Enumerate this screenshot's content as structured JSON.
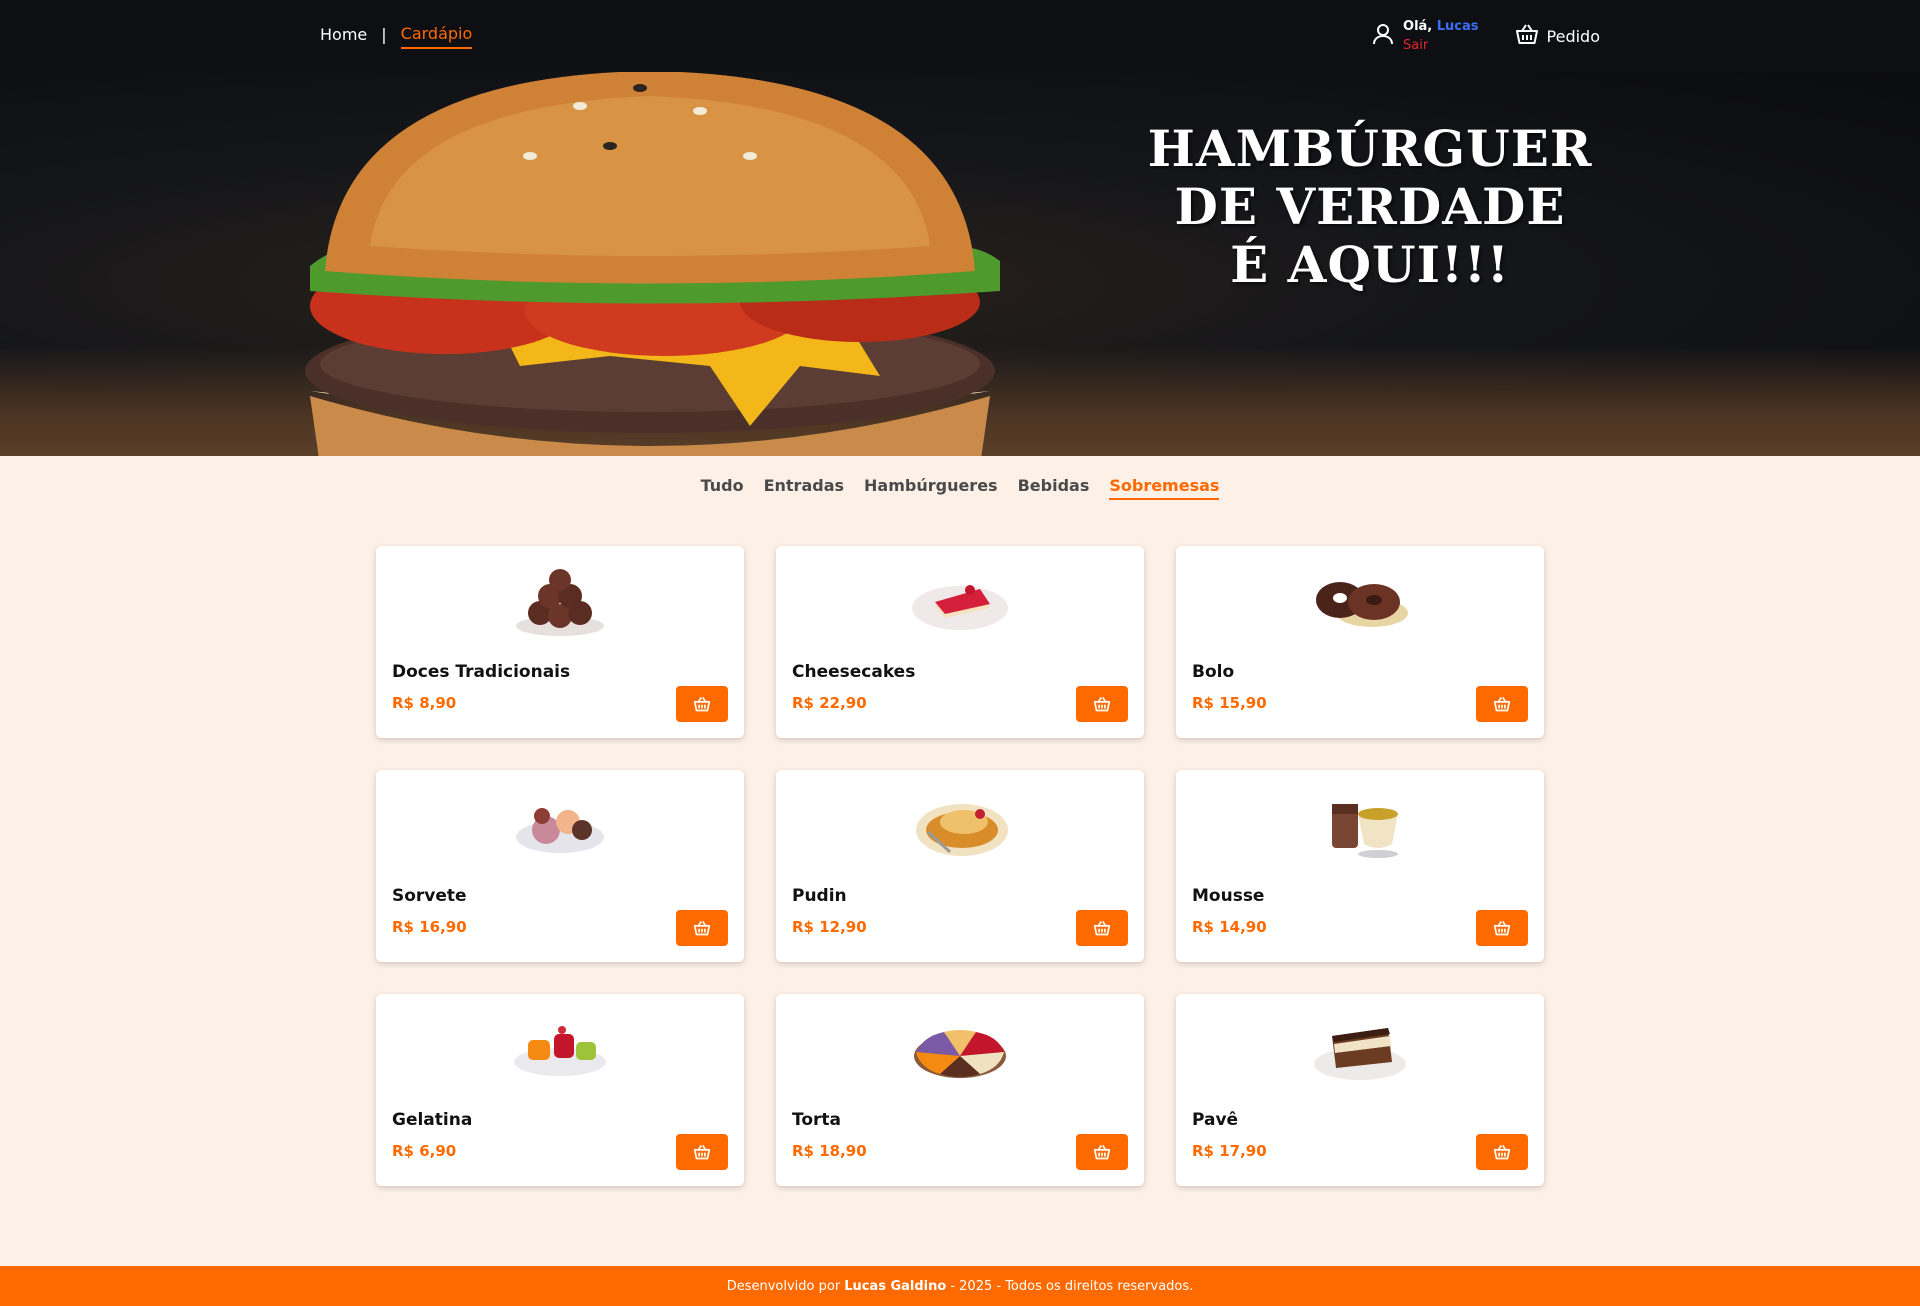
{
  "header": {
    "nav": [
      {
        "label": "Home",
        "active": false
      },
      {
        "label": "Cardápio",
        "active": true
      }
    ],
    "separator": "|",
    "user": {
      "greeting": "Olá,",
      "name": "Lucas",
      "logout": "Sair"
    },
    "cart_label": "Pedido",
    "colors": {
      "bar": "#0d0f13",
      "accent": "#ff6a00",
      "name": "#3b6ff5",
      "logout": "#e5262e"
    }
  },
  "hero": {
    "lines": [
      "HAMBÚRGUER",
      "DE VERDADE",
      "É AQUI!!!"
    ]
  },
  "tabs": [
    {
      "label": "Tudo",
      "active": false
    },
    {
      "label": "Entradas",
      "active": false
    },
    {
      "label": "Hambúrgueres",
      "active": false
    },
    {
      "label": "Bebidas",
      "active": false
    },
    {
      "label": "Sobremesas",
      "active": true
    }
  ],
  "products": [
    {
      "name": "Doces Tradicionais",
      "price": "R$ 8,90",
      "image": "brigadeiros"
    },
    {
      "name": "Cheesecakes",
      "price": "R$ 22,90",
      "image": "cheesecake"
    },
    {
      "name": "Bolo",
      "price": "R$ 15,90",
      "image": "bolo"
    },
    {
      "name": "Sorvete",
      "price": "R$ 16,90",
      "image": "sorvete"
    },
    {
      "name": "Pudin",
      "price": "R$ 12,90",
      "image": "pudim"
    },
    {
      "name": "Mousse",
      "price": "R$ 14,90",
      "image": "mousse"
    },
    {
      "name": "Gelatina",
      "price": "R$ 6,90",
      "image": "gelatina"
    },
    {
      "name": "Torta",
      "price": "R$ 18,90",
      "image": "torta"
    },
    {
      "name": "Pavê",
      "price": "R$ 17,90",
      "image": "pave"
    }
  ],
  "icons": {
    "user": "user-icon",
    "cart": "basket-icon",
    "add": "basket-icon"
  },
  "footer": {
    "prefix": "Desenvolvido por",
    "author": "Lucas Galdino",
    "suffix": "- 2025 - Todos os direitos reservados."
  }
}
